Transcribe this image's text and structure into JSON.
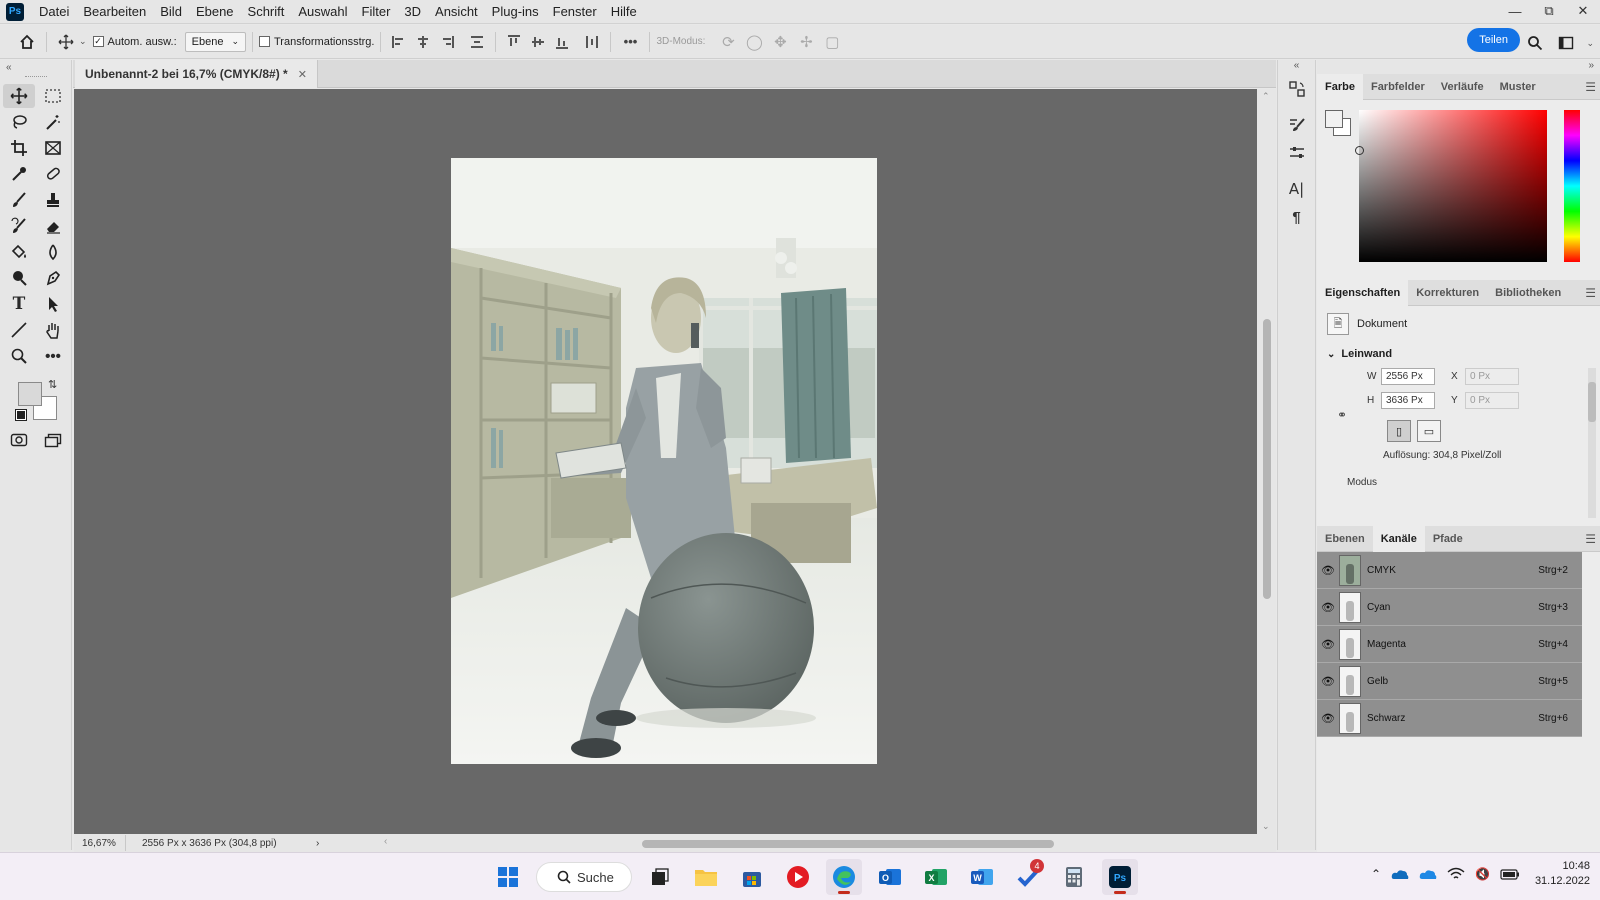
{
  "app": {
    "logo": "Ps",
    "menu": [
      "Datei",
      "Bearbeiten",
      "Bild",
      "Ebene",
      "Schrift",
      "Auswahl",
      "Filter",
      "3D",
      "Ansicht",
      "Plug-ins",
      "Fenster",
      "Hilfe"
    ]
  },
  "options_bar": {
    "auto_select_label": "Autom. ausw.:",
    "auto_select_checked": true,
    "target_select": "Ebene",
    "transform_label": "Transformationsstrg.",
    "transform_checked": false,
    "mode_3d_label": "3D-Modus:",
    "more_label": "•••",
    "share_label": "Teilen"
  },
  "document": {
    "tab_title": "Unbenannt-2 bei 16,7% (CMYK/8#) *",
    "zoom": "16,67%",
    "info": "2556 Px x 3636 Px (304,8 ppi)"
  },
  "color_panel": {
    "tabs": [
      "Farbe",
      "Farbfelder",
      "Verläufe",
      "Muster"
    ],
    "active_tab": "Farbe",
    "foreground": "#f1f1f1",
    "background": "#ffffff"
  },
  "properties_panel": {
    "tabs": [
      "Eigenschaften",
      "Korrekturen",
      "Bibliotheken"
    ],
    "active_tab": "Eigenschaften",
    "document_label": "Dokument",
    "section": "Leinwand",
    "width_label": "W",
    "width_value": "2556 Px",
    "height_label": "H",
    "height_value": "3636 Px",
    "x_label": "X",
    "x_value": "0 Px",
    "y_label": "Y",
    "y_value": "0 Px",
    "resolution": "Auflösung: 304,8 Pixel/Zoll",
    "mode_label": "Modus"
  },
  "channels_panel": {
    "tabs": [
      "Ebenen",
      "Kanäle",
      "Pfade"
    ],
    "active_tab": "Kanäle",
    "channels": [
      {
        "name": "CMYK",
        "shortcut": "Strg+2"
      },
      {
        "name": "Cyan",
        "shortcut": "Strg+3"
      },
      {
        "name": "Magenta",
        "shortcut": "Strg+4"
      },
      {
        "name": "Gelb",
        "shortcut": "Strg+5"
      },
      {
        "name": "Schwarz",
        "shortcut": "Strg+6"
      }
    ]
  },
  "taskbar": {
    "search_label": "Suche",
    "todo_badge": "4",
    "time": "10:48",
    "date": "31.12.2022"
  }
}
